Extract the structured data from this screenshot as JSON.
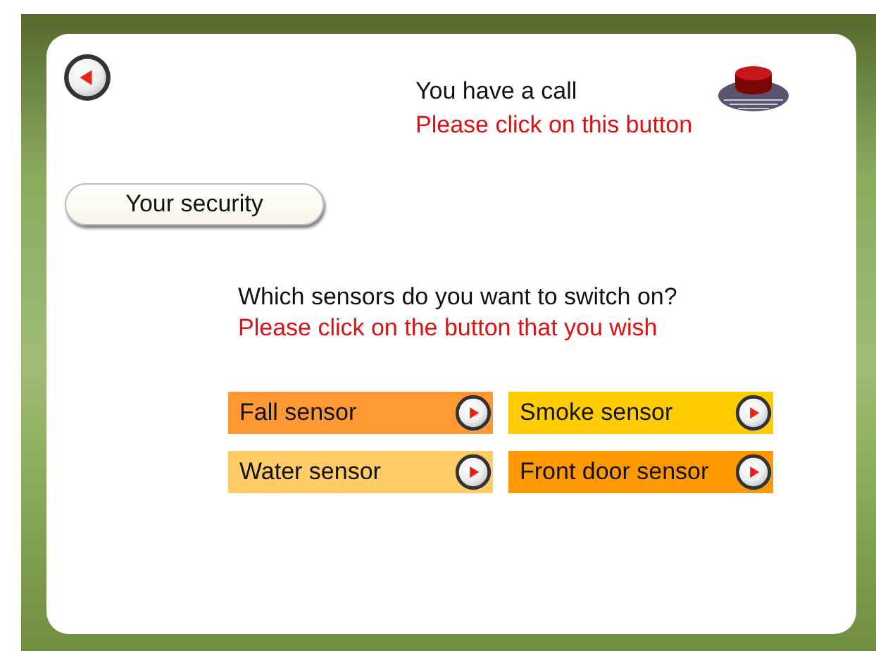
{
  "call": {
    "title": "You have a call",
    "instruction": "Please click on this button"
  },
  "section_button": {
    "label": "Your security"
  },
  "question": {
    "title": "Which sensors do you want to switch on?",
    "instruction": "Please click on the button that you wish"
  },
  "sensors": [
    {
      "label": "Fall sensor",
      "color": "#ff9933"
    },
    {
      "label": "Smoke sensor",
      "color": "#ffcc00"
    },
    {
      "label": "Water sensor",
      "color": "#ffcc66"
    },
    {
      "label": "Front door sensor",
      "color": "#ff9900"
    }
  ]
}
